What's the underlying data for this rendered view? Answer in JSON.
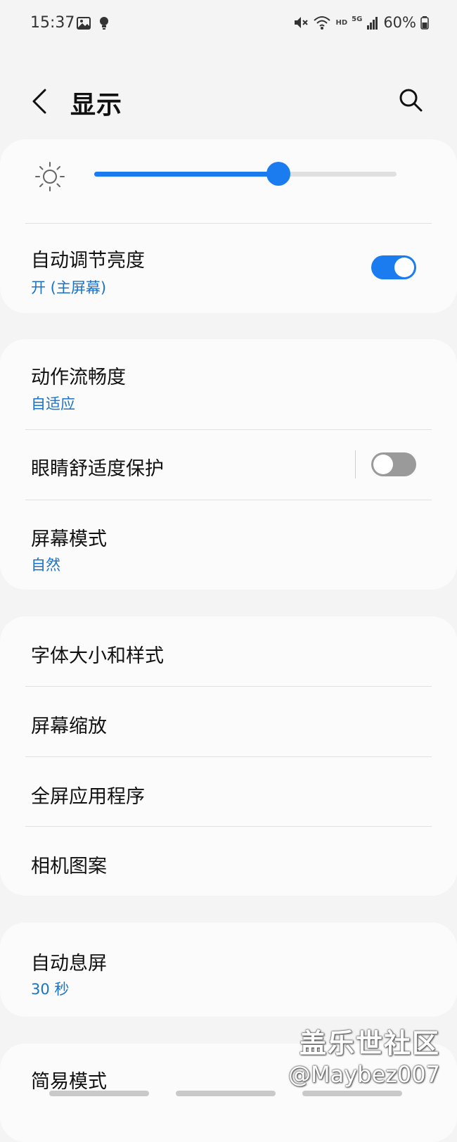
{
  "status_bar": {
    "time": "15:37",
    "network_hd": "HD",
    "network_5g": "5G",
    "battery": "60%",
    "icons": [
      "image-icon",
      "bulb-icon",
      "mute-icon",
      "wifi-icon",
      "signal-icon",
      "battery-icon"
    ]
  },
  "header": {
    "title": "显示",
    "back_icon": "chevron-left-icon",
    "search_icon": "search-icon"
  },
  "brightness": {
    "level": 0.61,
    "accent": "#1b7cf0"
  },
  "auto_brightness": {
    "title": "自动调节亮度",
    "subtitle": "开 (主屏幕)",
    "enabled": true
  },
  "group2": {
    "motion": {
      "title": "动作流畅度",
      "subtitle": "自适应"
    },
    "eye_comfort": {
      "title": "眼睛舒适度保护",
      "enabled": false
    },
    "screen_mode": {
      "title": "屏幕模式",
      "subtitle": "自然"
    }
  },
  "group3": {
    "items": [
      "字体大小和样式",
      "屏幕缩放",
      "全屏应用程序",
      "相机图案"
    ]
  },
  "screen_timeout": {
    "title": "自动息屏",
    "subtitle": "30 秒"
  },
  "easy_mode": {
    "title": "简易模式"
  },
  "watermark": {
    "line1": "盖乐世社区",
    "line2": "@Maybez007"
  }
}
